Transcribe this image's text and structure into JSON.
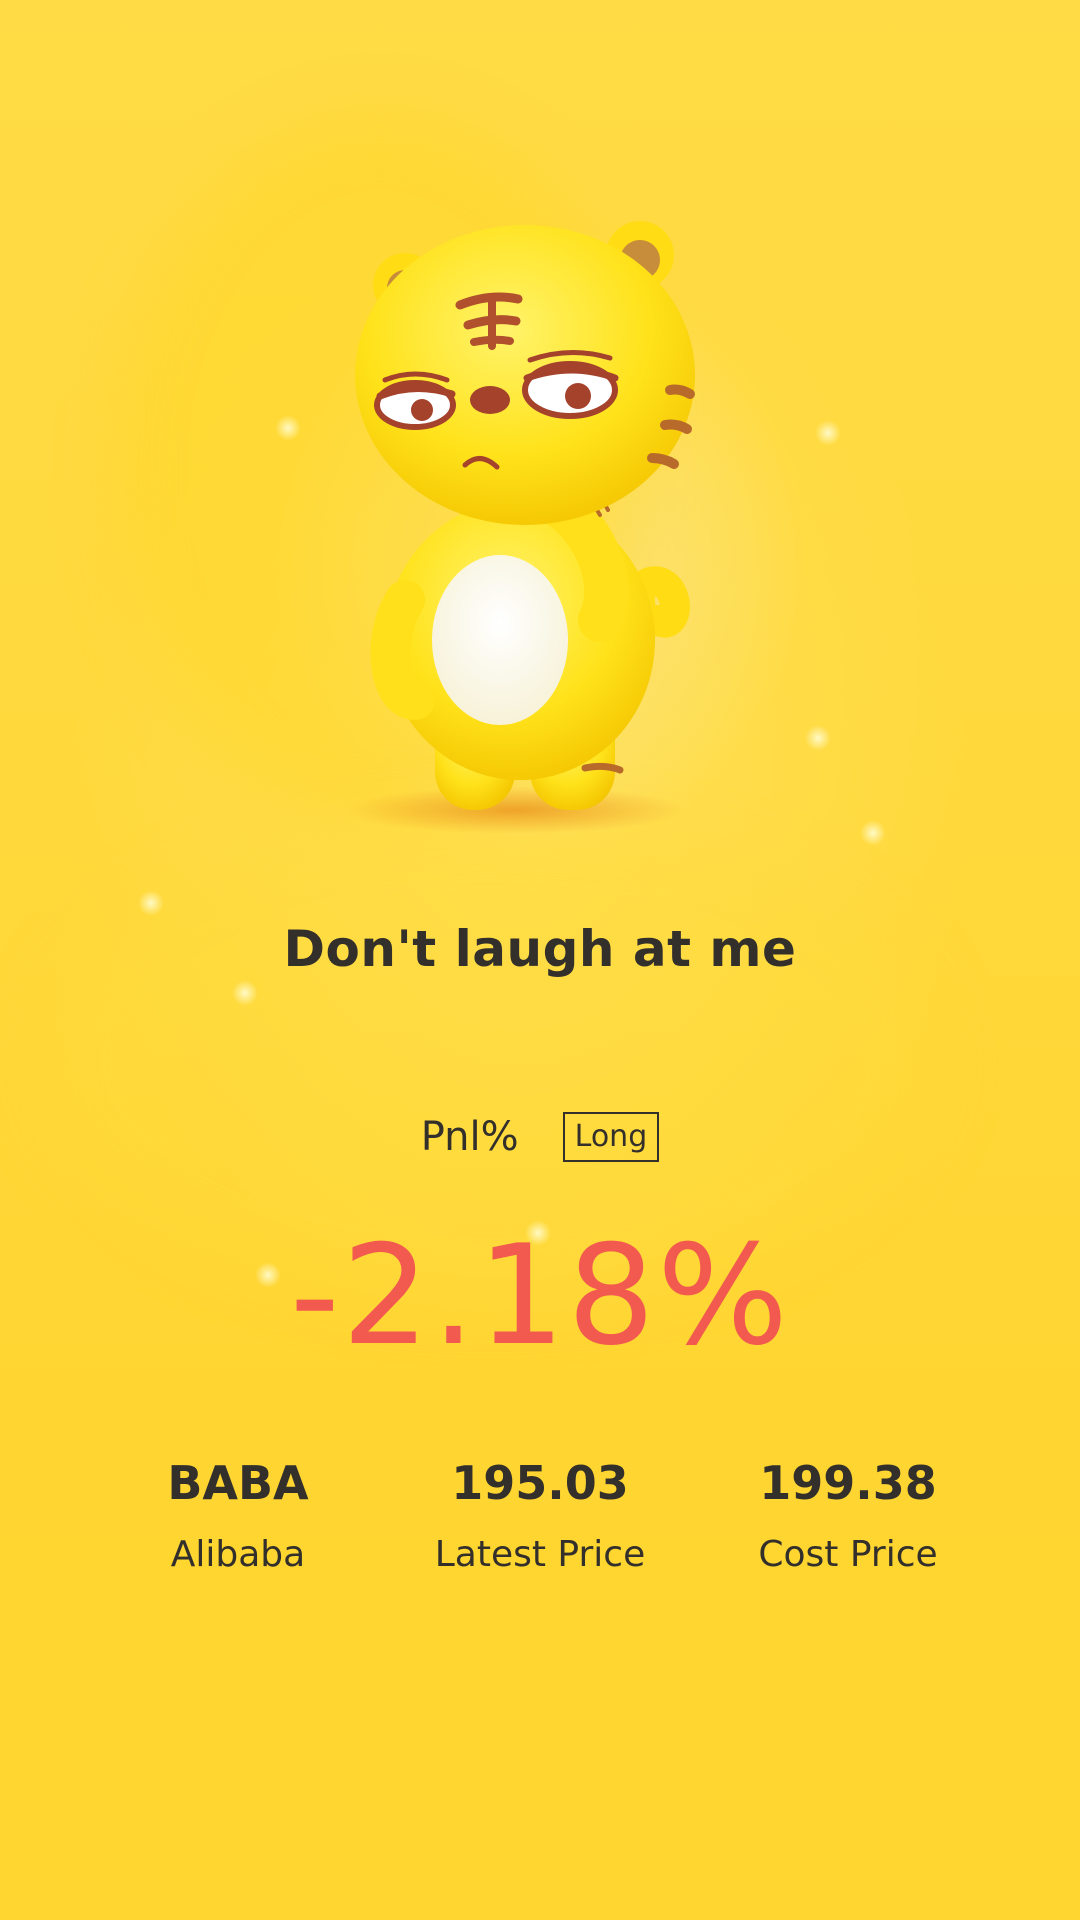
{
  "mascot": {
    "icon": "tiger-mascot-icon"
  },
  "title": "Don't laugh at me",
  "pnl": {
    "label": "Pnl%",
    "position": "Long",
    "value": "-2.18%",
    "value_color": "#f25a50"
  },
  "stats": [
    {
      "value": "BABA",
      "label": "Alibaba"
    },
    {
      "value": "195.03",
      "label": "Latest Price"
    },
    {
      "value": "199.38",
      "label": "Cost Price"
    }
  ],
  "colors": {
    "background": "#ffd63a",
    "text": "#33302b",
    "loss": "#f25a50"
  }
}
